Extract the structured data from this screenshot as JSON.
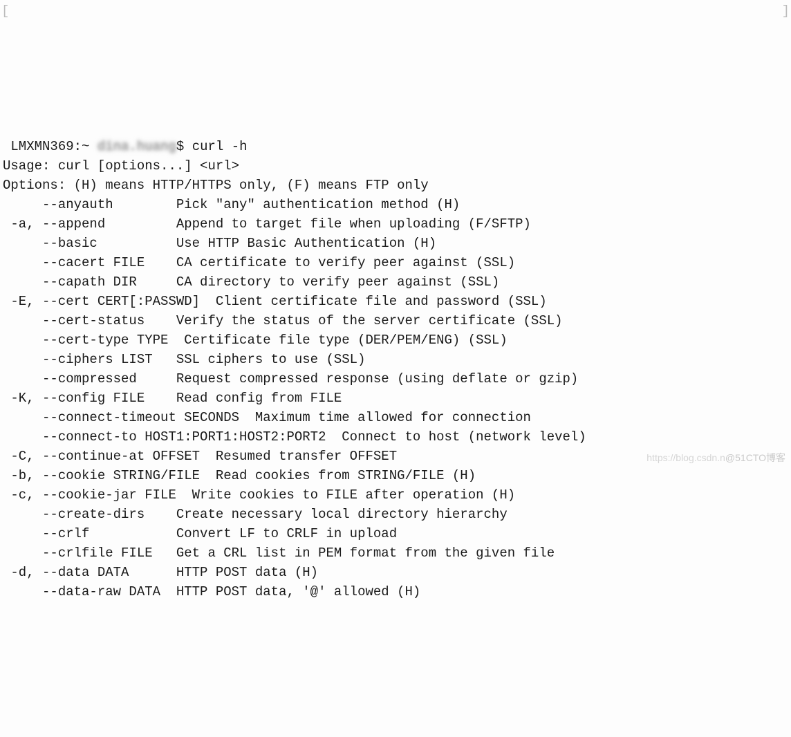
{
  "prompt": {
    "host": "LMXMN369",
    "path": "~",
    "user_censored": "dina.huang",
    "suffix": "$",
    "command": "curl -h"
  },
  "usage": "Usage: curl [options...] <url>",
  "options_header": "Options: (H) means HTTP/HTTPS only, (F) means FTP only",
  "options": [
    {
      "short": "",
      "long": "--anyauth",
      "arg": "",
      "desc": "Pick \"any\" authentication method (H)"
    },
    {
      "short": "-a,",
      "long": "--append",
      "arg": "",
      "desc": "Append to target file when uploading (F/SFTP)"
    },
    {
      "short": "",
      "long": "--basic",
      "arg": "",
      "desc": "Use HTTP Basic Authentication (H)"
    },
    {
      "short": "",
      "long": "--cacert",
      "arg": "FILE",
      "desc": "CA certificate to verify peer against (SSL)"
    },
    {
      "short": "",
      "long": "--capath",
      "arg": "DIR",
      "desc": "CA directory to verify peer against (SSL)"
    },
    {
      "short": "-E,",
      "long": "--cert",
      "arg": "CERT[:PASSWD]",
      "desc": "Client certificate file and password (SSL)"
    },
    {
      "short": "",
      "long": "--cert-status",
      "arg": "",
      "desc": "Verify the status of the server certificate (SSL)"
    },
    {
      "short": "",
      "long": "--cert-type",
      "arg": "TYPE",
      "desc": "Certificate file type (DER/PEM/ENG) (SSL)"
    },
    {
      "short": "",
      "long": "--ciphers",
      "arg": "LIST",
      "desc": "SSL ciphers to use (SSL)"
    },
    {
      "short": "",
      "long": "--compressed",
      "arg": "",
      "desc": "Request compressed response (using deflate or gzip)"
    },
    {
      "short": "-K,",
      "long": "--config",
      "arg": "FILE",
      "desc": "Read config from FILE"
    },
    {
      "short": "",
      "long": "--connect-timeout",
      "arg": "SECONDS",
      "desc": "Maximum time allowed for connection"
    },
    {
      "short": "",
      "long": "--connect-to",
      "arg": "HOST1:PORT1:HOST2:PORT2",
      "desc": "Connect to host (network level)"
    },
    {
      "short": "-C,",
      "long": "--continue-at",
      "arg": "OFFSET",
      "desc": "Resumed transfer OFFSET"
    },
    {
      "short": "-b,",
      "long": "--cookie",
      "arg": "STRING/FILE",
      "desc": "Read cookies from STRING/FILE (H)"
    },
    {
      "short": "-c,",
      "long": "--cookie-jar",
      "arg": "FILE",
      "desc": "Write cookies to FILE after operation (H)"
    },
    {
      "short": "",
      "long": "--create-dirs",
      "arg": "",
      "desc": "Create necessary local directory hierarchy"
    },
    {
      "short": "",
      "long": "--crlf",
      "arg": "",
      "desc": "Convert LF to CRLF in upload"
    },
    {
      "short": "",
      "long": "--crlfile",
      "arg": "FILE",
      "desc": "Get a CRL list in PEM format from the given file"
    },
    {
      "short": "-d,",
      "long": "--data",
      "arg": "DATA",
      "desc": "HTTP POST data (H)"
    },
    {
      "short": "",
      "long": "--data-raw",
      "arg": "DATA",
      "desc": "HTTP POST data, '@' allowed (H)"
    }
  ],
  "watermark": {
    "faded": "https://blog.csdn.n",
    "handle": "@51CTO博客"
  }
}
